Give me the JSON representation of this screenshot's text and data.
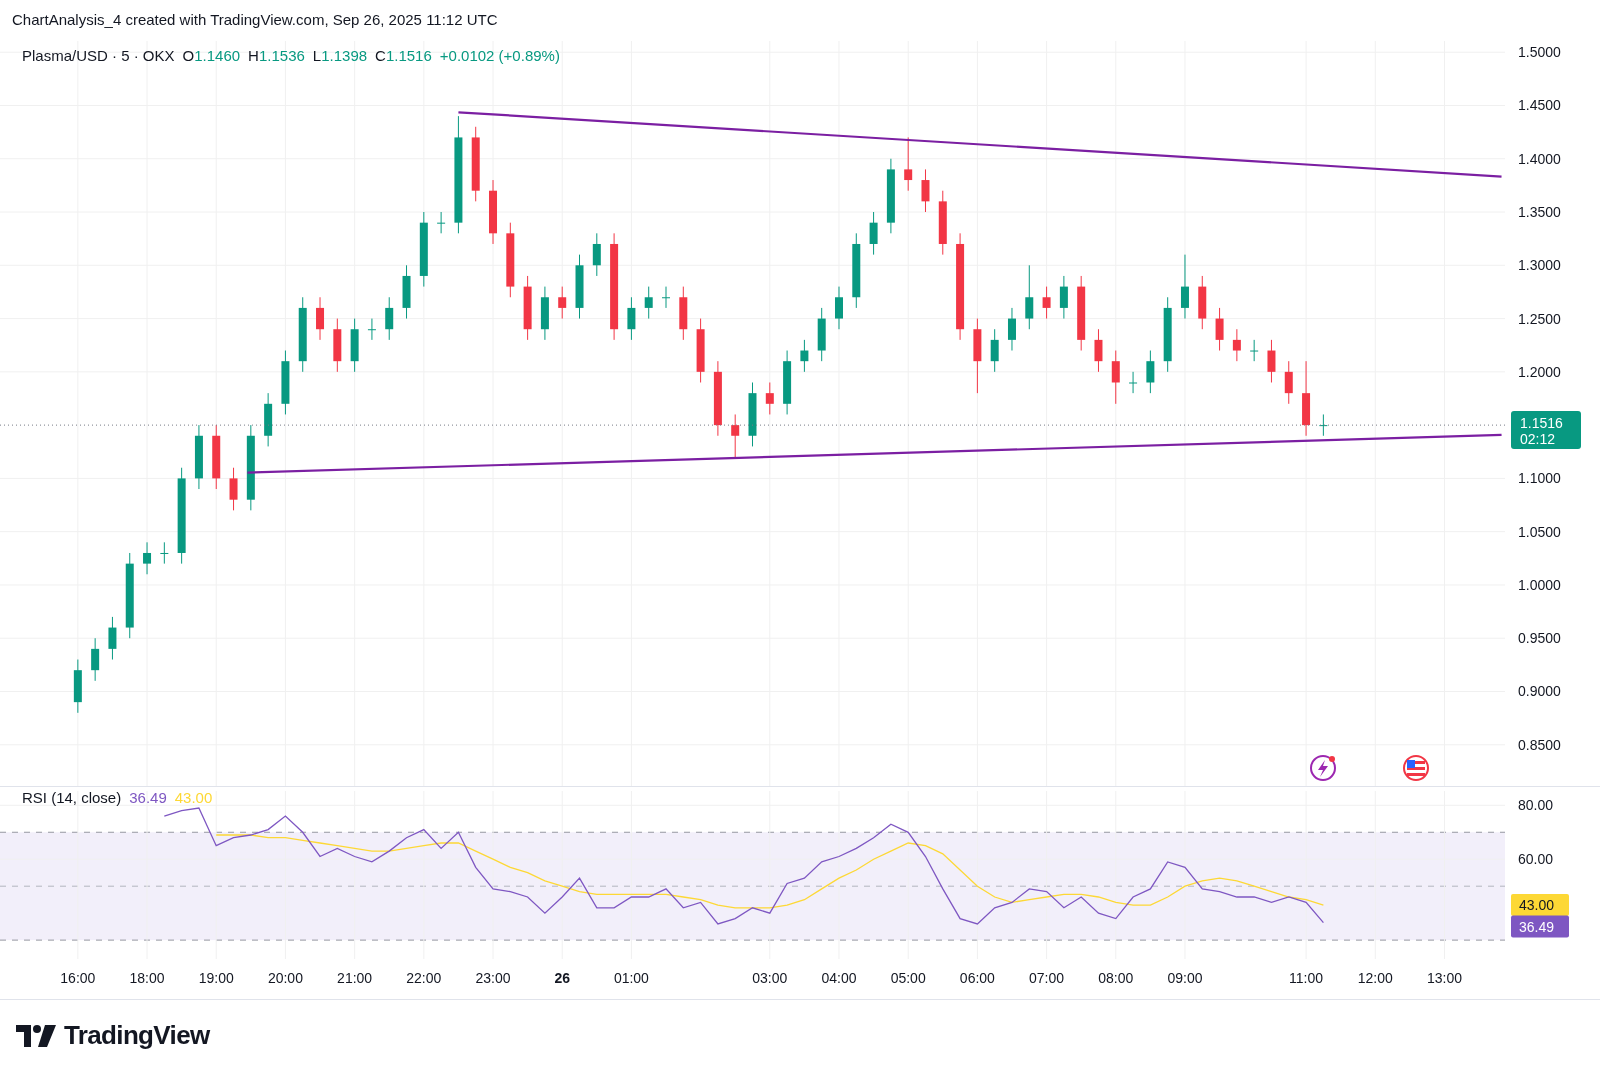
{
  "header": {
    "title": "ChartAnalysis_4 created with TradingView.com, Sep 26, 2025 11:12 UTC"
  },
  "legend": {
    "symbol": "Plasma/USD · 5 · OKX",
    "fields": [
      {
        "label": "O",
        "value": "1.1460"
      },
      {
        "label": "H",
        "value": "1.1536"
      },
      {
        "label": "L",
        "value": "1.1398"
      },
      {
        "label": "C",
        "value": "1.1516"
      }
    ],
    "change": "+0.0102 (+0.89%)"
  },
  "price_pane": {
    "last_price": {
      "price": "1.1516",
      "countdown": "02:12"
    },
    "chart_data": {
      "type": "candlestick",
      "grid": true,
      "ylim": [
        0.8113,
        1.5105
      ],
      "yticks": [
        {
          "value": 1.5,
          "label": "1.5000"
        },
        {
          "value": 1.45,
          "label": "1.4500"
        },
        {
          "value": 1.4,
          "label": "1.4000"
        },
        {
          "value": 1.35,
          "label": "1.3500"
        },
        {
          "value": 1.3,
          "label": "1.3000"
        },
        {
          "value": 1.25,
          "label": "1.2500"
        },
        {
          "value": 1.2,
          "label": "1.2000"
        },
        {
          "value": 1.1,
          "label": "1.1000"
        },
        {
          "value": 1.05,
          "label": "1.0500"
        },
        {
          "value": 1.0,
          "label": "1.0000"
        },
        {
          "value": 0.95,
          "label": "0.9500"
        },
        {
          "value": 0.9,
          "label": "0.9000"
        },
        {
          "value": 0.85,
          "label": "0.8500"
        }
      ],
      "categories": [
        null,
        null,
        null,
        null,
        null,
        null,
        null,
        null,
        null,
        null,
        null,
        null,
        null,
        null,
        null,
        null,
        null,
        null,
        null,
        null,
        null,
        null,
        null,
        null,
        null,
        null,
        null,
        null,
        null,
        null,
        null,
        null,
        null,
        null,
        null,
        null,
        null,
        null,
        null,
        null,
        null,
        null,
        null,
        null,
        null,
        null,
        null,
        null,
        null,
        null,
        null,
        null,
        null,
        null,
        null,
        null,
        null,
        null,
        null,
        null,
        null,
        null,
        null,
        null,
        null,
        null,
        null,
        null,
        null,
        null,
        null,
        null,
        null,
        null,
        null,
        null,
        null,
        null,
        null,
        null,
        null,
        null,
        null,
        null,
        null,
        null,
        null
      ],
      "ohlc": [
        null,
        null,
        null,
        null,
        [
          0.89,
          0.93,
          0.88,
          0.92
        ],
        [
          0.92,
          0.95,
          0.91,
          0.94
        ],
        [
          0.94,
          0.97,
          0.93,
          0.96
        ],
        [
          0.96,
          1.03,
          0.95,
          1.02
        ],
        [
          1.02,
          1.04,
          1.01,
          1.03
        ],
        [
          1.03,
          1.04,
          1.02,
          1.03
        ],
        [
          1.03,
          1.11,
          1.02,
          1.1
        ],
        [
          1.1,
          1.15,
          1.09,
          1.14
        ],
        [
          1.14,
          1.15,
          1.09,
          1.1
        ],
        [
          1.1,
          1.11,
          1.07,
          1.08
        ],
        [
          1.08,
          1.15,
          1.07,
          1.14
        ],
        [
          1.14,
          1.18,
          1.13,
          1.17
        ],
        [
          1.17,
          1.22,
          1.16,
          1.21
        ],
        [
          1.21,
          1.27,
          1.2,
          1.26
        ],
        [
          1.26,
          1.27,
          1.23,
          1.24
        ],
        [
          1.24,
          1.25,
          1.2,
          1.21
        ],
        [
          1.21,
          1.25,
          1.2,
          1.24
        ],
        [
          1.24,
          1.25,
          1.23,
          1.24
        ],
        [
          1.24,
          1.27,
          1.23,
          1.26
        ],
        [
          1.26,
          1.3,
          1.25,
          1.29
        ],
        [
          1.29,
          1.35,
          1.28,
          1.34
        ],
        [
          1.34,
          1.35,
          1.33,
          1.34
        ],
        [
          1.34,
          1.44,
          1.33,
          1.42
        ],
        [
          1.42,
          1.43,
          1.36,
          1.37
        ],
        [
          1.37,
          1.38,
          1.32,
          1.33
        ],
        [
          1.33,
          1.34,
          1.27,
          1.28
        ],
        [
          1.28,
          1.29,
          1.23,
          1.24
        ],
        [
          1.24,
          1.28,
          1.23,
          1.27
        ],
        [
          1.27,
          1.28,
          1.25,
          1.26
        ],
        [
          1.26,
          1.31,
          1.25,
          1.3
        ],
        [
          1.3,
          1.33,
          1.29,
          1.32
        ],
        [
          1.32,
          1.33,
          1.23,
          1.24
        ],
        [
          1.24,
          1.27,
          1.23,
          1.26
        ],
        [
          1.26,
          1.28,
          1.25,
          1.27
        ],
        [
          1.27,
          1.28,
          1.26,
          1.27
        ],
        [
          1.27,
          1.28,
          1.23,
          1.24
        ],
        [
          1.24,
          1.25,
          1.19,
          1.2
        ],
        [
          1.2,
          1.21,
          1.14,
          1.15
        ],
        [
          1.15,
          1.16,
          1.12,
          1.14
        ],
        [
          1.14,
          1.19,
          1.13,
          1.18
        ],
        [
          1.18,
          1.19,
          1.16,
          1.17
        ],
        [
          1.17,
          1.22,
          1.16,
          1.21
        ],
        [
          1.21,
          1.23,
          1.2,
          1.22
        ],
        [
          1.22,
          1.26,
          1.21,
          1.25
        ],
        [
          1.25,
          1.28,
          1.24,
          1.27
        ],
        [
          1.27,
          1.33,
          1.26,
          1.32
        ],
        [
          1.32,
          1.35,
          1.31,
          1.34
        ],
        [
          1.34,
          1.4,
          1.33,
          1.39
        ],
        [
          1.39,
          1.42,
          1.37,
          1.38
        ],
        [
          1.38,
          1.39,
          1.35,
          1.36
        ],
        [
          1.36,
          1.37,
          1.31,
          1.32
        ],
        [
          1.32,
          1.33,
          1.23,
          1.24
        ],
        [
          1.24,
          1.25,
          1.18,
          1.21
        ],
        [
          1.21,
          1.24,
          1.2,
          1.23
        ],
        [
          1.23,
          1.26,
          1.22,
          1.25
        ],
        [
          1.25,
          1.3,
          1.24,
          1.27
        ],
        [
          1.27,
          1.28,
          1.25,
          1.26
        ],
        [
          1.26,
          1.29,
          1.25,
          1.28
        ],
        [
          1.28,
          1.29,
          1.22,
          1.23
        ],
        [
          1.23,
          1.24,
          1.2,
          1.21
        ],
        [
          1.21,
          1.22,
          1.17,
          1.19
        ],
        [
          1.19,
          1.2,
          1.18,
          1.19
        ],
        [
          1.19,
          1.22,
          1.18,
          1.21
        ],
        [
          1.21,
          1.27,
          1.2,
          1.26
        ],
        [
          1.26,
          1.31,
          1.25,
          1.28
        ],
        [
          1.28,
          1.29,
          1.24,
          1.25
        ],
        [
          1.25,
          1.26,
          1.22,
          1.23
        ],
        [
          1.23,
          1.24,
          1.21,
          1.22
        ],
        [
          1.22,
          1.23,
          1.21,
          1.22
        ],
        [
          1.22,
          1.23,
          1.19,
          1.2
        ],
        [
          1.2,
          1.21,
          1.17,
          1.18
        ],
        [
          1.18,
          1.21,
          1.14,
          1.15
        ],
        [
          1.15,
          1.16,
          1.14,
          1.15
        ],
        null,
        null,
        null,
        null,
        null,
        null,
        null,
        null,
        null,
        null
      ]
    }
  },
  "rsi_pane": {
    "values": [
      "36.49",
      "43.00"
    ],
    "axis_badges": [
      "43.00",
      "36.49"
    ],
    "chart_data": {
      "type": "line",
      "grid": true,
      "ylim": [
        23,
        85.3
      ],
      "yticks": [
        {
          "value": 80,
          "label": "80.00"
        },
        {
          "value": 60,
          "label": "60.00"
        }
      ],
      "categories": [
        null,
        null,
        null,
        null,
        "16:00",
        null,
        null,
        null,
        "18:00",
        null,
        null,
        null,
        "19:00",
        null,
        null,
        null,
        "20:00",
        null,
        null,
        null,
        "21:00",
        null,
        null,
        null,
        "22:00",
        null,
        null,
        null,
        "23:00",
        null,
        null,
        null,
        "**26**",
        null,
        null,
        null,
        "01:00",
        null,
        null,
        null,
        null,
        null,
        null,
        null,
        "03:00",
        null,
        null,
        null,
        "04:00",
        null,
        null,
        null,
        "05:00",
        null,
        null,
        null,
        "06:00",
        null,
        null,
        null,
        "07:00",
        null,
        null,
        null,
        "08:00",
        null,
        null,
        null,
        "09:00",
        null,
        null,
        null,
        null,
        null,
        null,
        "11:00",
        null,
        null,
        null,
        "12:00",
        null,
        null,
        null,
        "13:00",
        null,
        null,
        null
      ],
      "series": [
        {
          "name": "RSI (14, close)",
          "color": "#7e57c2",
          "values": [
            null,
            null,
            null,
            null,
            null,
            null,
            null,
            null,
            null,
            76,
            78,
            79,
            65,
            68,
            69,
            71,
            76,
            70,
            61,
            64,
            61,
            59,
            63,
            68,
            71,
            64,
            70,
            57,
            49,
            48,
            46,
            40,
            46,
            53,
            42,
            42,
            46,
            46,
            49,
            42,
            44,
            36,
            38,
            42,
            40,
            51,
            53,
            59,
            61,
            64,
            68,
            73,
            70,
            61,
            49,
            38,
            36,
            42,
            44,
            49,
            48,
            42,
            46,
            40,
            38,
            46,
            49,
            59,
            57,
            49,
            48,
            46,
            46,
            44,
            46,
            44,
            36.5,
            null,
            null,
            null,
            null,
            null,
            null,
            null,
            null,
            null,
            null
          ]
        },
        {
          "color": "#fdd835",
          "values": [
            null,
            null,
            null,
            null,
            null,
            null,
            null,
            null,
            null,
            null,
            null,
            null,
            69,
            69,
            69,
            68,
            68,
            67,
            66,
            65,
            64,
            63,
            63,
            64,
            65,
            66,
            66,
            63,
            60,
            57,
            55,
            52,
            50,
            48,
            47,
            47,
            47,
            47,
            47,
            46,
            45,
            43,
            42,
            42,
            42,
            43,
            45,
            49,
            53,
            56,
            60,
            63,
            66,
            65,
            62,
            56,
            50,
            46,
            44,
            45,
            46,
            47,
            47,
            46,
            44,
            43,
            43,
            46,
            50,
            52,
            53,
            52,
            50,
            48,
            46,
            45,
            43,
            null,
            null,
            null,
            null,
            null,
            null,
            null,
            null,
            null,
            null
          ]
        }
      ]
    }
  },
  "footer": {
    "brand": "TradingView"
  }
}
